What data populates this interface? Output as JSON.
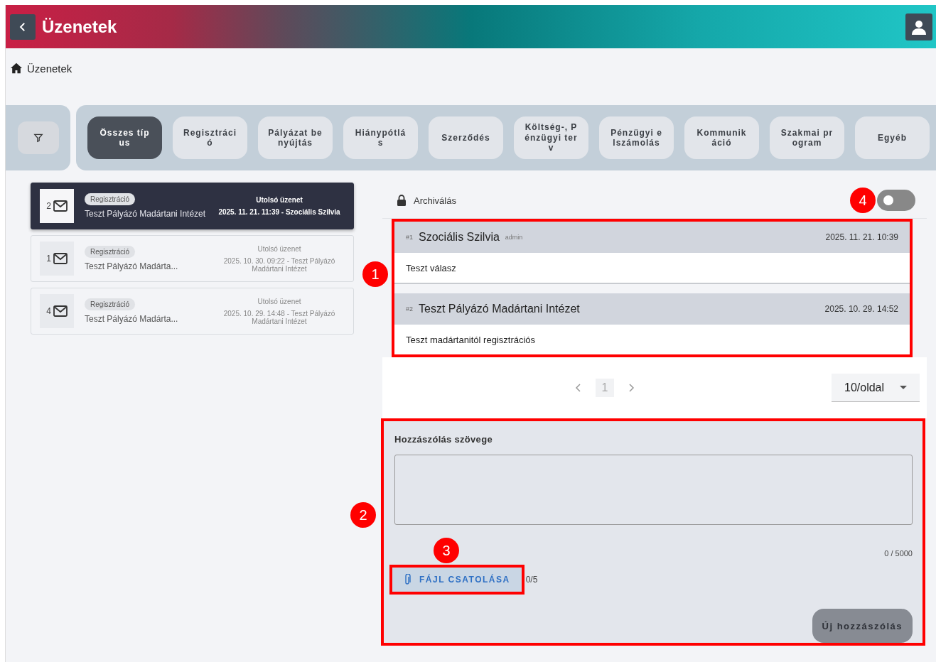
{
  "header": {
    "title": "Üzenetek"
  },
  "breadcrumb": {
    "label": "Üzenetek"
  },
  "filter_chips": [
    {
      "label": "Összes típus",
      "selected": true
    },
    {
      "label": "Regisztráció",
      "selected": false
    },
    {
      "label": "Pályázat benyújtás",
      "selected": false
    },
    {
      "label": "Hiánypótlás",
      "selected": false
    },
    {
      "label": "Szerződés",
      "selected": false
    },
    {
      "label": "Költség-, Pénzügyi terv",
      "selected": false
    },
    {
      "label": "Pénzügyi elszámolás",
      "selected": false
    },
    {
      "label": "Kommunikáció",
      "selected": false
    },
    {
      "label": "Szakmai program",
      "selected": false
    },
    {
      "label": "Egyéb",
      "selected": false
    }
  ],
  "threads": [
    {
      "count": "2",
      "tag": "Regisztráció",
      "title": "Teszt Pályázó Madártani Intézet",
      "last_label": "Utolsó üzenet",
      "last_info": "2025. 11. 21. 11:39 - Szociális Szilvia",
      "selected": true
    },
    {
      "count": "1",
      "tag": "Regisztráció",
      "title": "Teszt Pályázó Madárta...",
      "last_label": "Utolsó üzenet",
      "last_info": "2025. 10. 30. 09:22 - Teszt Pályázó Madártani Intézet",
      "selected": false
    },
    {
      "count": "4",
      "tag": "Regisztráció",
      "title": "Teszt Pályázó Madárta...",
      "last_label": "Utolsó üzenet",
      "last_info": "2025. 10. 29. 14:48 - Teszt Pályázó Madártani Intézet",
      "selected": false
    }
  ],
  "archive": {
    "label": "Archiválás",
    "on": false,
    "annotation": "4"
  },
  "messages_annotation": "1",
  "messages": [
    {
      "index": "#1",
      "author": "Szociális Szilvia",
      "role": "admin",
      "date": "2025. 11. 21. 10:39",
      "body": "Teszt válasz"
    },
    {
      "index": "#2",
      "author": "Teszt Pályázó Madártani Intézet",
      "date": "2025. 10. 29. 14:52",
      "body": "Teszt madártanitól regisztrációs"
    }
  ],
  "pagination": {
    "page": "1",
    "per_page": "10/oldal"
  },
  "comment": {
    "label": "Hozzászólás szövege",
    "counter": "0 / 5000",
    "attach_label": "FÁJL CSATOLÁSA",
    "attach_count": "0/5",
    "submit_label": "Új hozzászólás",
    "submit_disabled": true,
    "annotation": "2",
    "attach_annotation": "3"
  }
}
